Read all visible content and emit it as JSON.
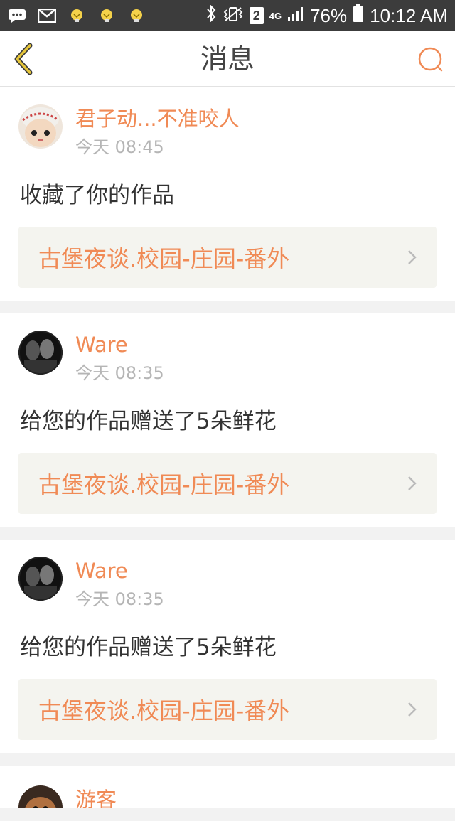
{
  "status_bar": {
    "battery": "76%",
    "time": "10:12 AM",
    "sim_badge": "2",
    "network": "4G"
  },
  "header": {
    "title": "消息"
  },
  "messages": [
    {
      "username": "君子动...不准咬人",
      "timestamp": "今天 08:45",
      "action": "收藏了你的作品",
      "work_title": "古堡夜谈.校园-庄园-番外"
    },
    {
      "username": "Ware",
      "timestamp": "今天 08:35",
      "action": "给您的作品赠送了5朵鲜花",
      "work_title": "古堡夜谈.校园-庄园-番外"
    },
    {
      "username": "Ware",
      "timestamp": "今天 08:35",
      "action": "给您的作品赠送了5朵鲜花",
      "work_title": "古堡夜谈.校园-庄园-番外"
    },
    {
      "username": "游客"
    }
  ],
  "colors": {
    "accent": "#f08a55",
    "back_arrow": "#c9a21a",
    "status_bar_bg": "#3c3c3c"
  }
}
